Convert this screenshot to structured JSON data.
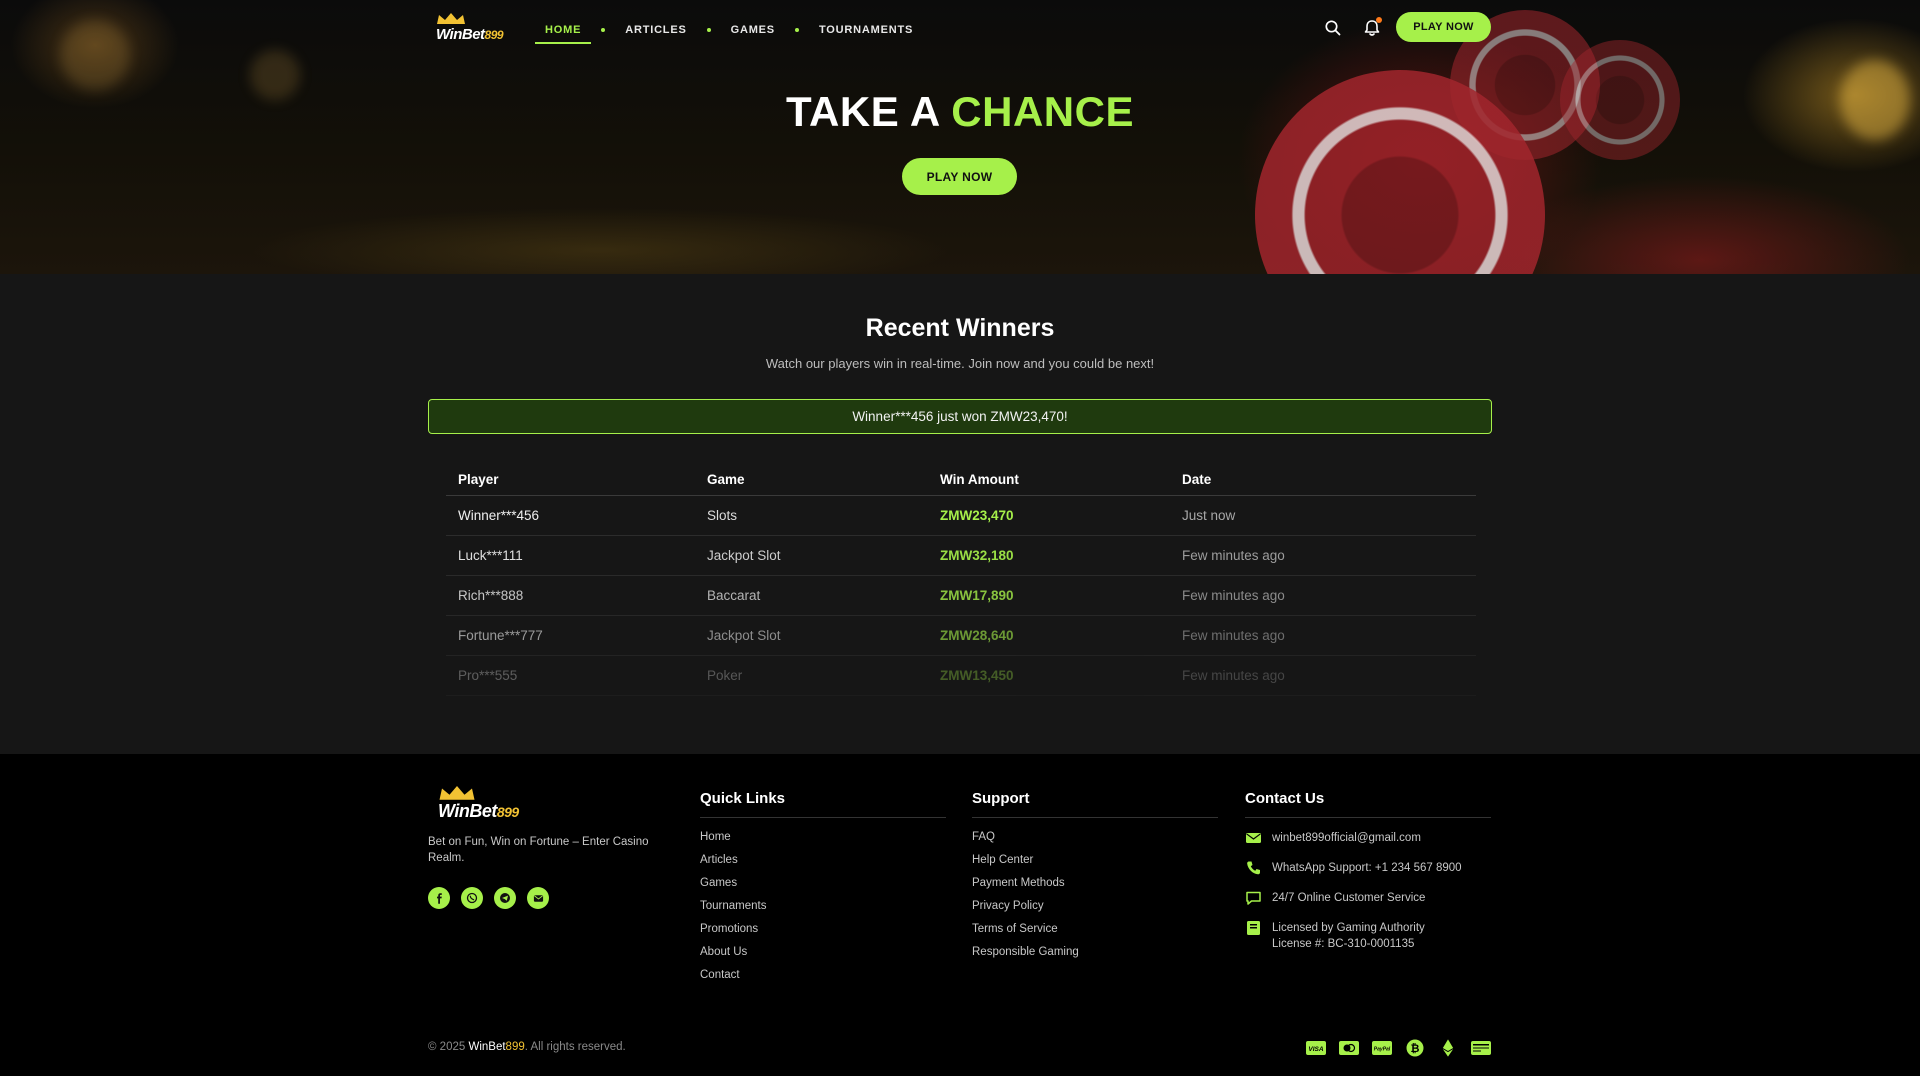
{
  "brand": {
    "name_main": "WinBet",
    "name_num": "899"
  },
  "nav": {
    "items": [
      {
        "label": "HOME",
        "active": true
      },
      {
        "label": "ARTICLES",
        "active": false
      },
      {
        "label": "GAMES",
        "active": false
      },
      {
        "label": "TOURNAMENTS",
        "active": false
      }
    ],
    "search_icon": "search-icon",
    "bell_icon": "bell-icon",
    "cta_label": "PLAY NOW"
  },
  "hero": {
    "title_prefix": "TAKE A",
    "title_accent": "CHANCE",
    "cta_label": "PLAY NOW"
  },
  "winners": {
    "title": "Recent Winners",
    "subtitle": "Watch our players win in real-time. Join now and you could be next!",
    "ticker": "Winner***456 just won ZMW23,470!",
    "headers": {
      "player": "Player",
      "game": "Game",
      "amount": "Win Amount",
      "date": "Date"
    },
    "rows": [
      {
        "player": "Winner***456",
        "game": "Slots",
        "amount": "ZMW23,470",
        "date": "Just now"
      },
      {
        "player": "Luck***111",
        "game": "Jackpot Slot",
        "amount": "ZMW32,180",
        "date": "Few minutes ago"
      },
      {
        "player": "Rich***888",
        "game": "Baccarat",
        "amount": "ZMW17,890",
        "date": "Few minutes ago"
      },
      {
        "player": "Fortune***777",
        "game": "Jackpot Slot",
        "amount": "ZMW28,640",
        "date": "Few minutes ago"
      },
      {
        "player": "Pro***555",
        "game": "Poker",
        "amount": "ZMW13,450",
        "date": "Few minutes ago"
      }
    ]
  },
  "footer": {
    "tagline": "Bet on Fun, Win on Fortune – Enter Casino Realm.",
    "socials": [
      "facebook-icon",
      "whatsapp-icon",
      "telegram-icon",
      "email-icon"
    ],
    "quick_links": {
      "title": "Quick Links",
      "links": [
        "Home",
        "Articles",
        "Games",
        "Tournaments",
        "Promotions",
        "About Us",
        "Contact"
      ]
    },
    "support": {
      "title": "Support",
      "links": [
        "FAQ",
        "Help Center",
        "Payment Methods",
        "Privacy Policy",
        "Terms of Service",
        "Responsible Gaming"
      ]
    },
    "contact": {
      "title": "Contact Us",
      "email": "winbet899official@gmail.com",
      "whatsapp": "WhatsApp Support: +1 234 567 8900",
      "service": "24/7 Online Customer Service",
      "license_line1": "Licensed by Gaming Authority",
      "license_line2": "License #: BC-310-0001135"
    },
    "copyright_prefix": "© 2025",
    "copyright_suffix": ". All rights reserved.",
    "payments": [
      "visa-icon",
      "mastercard-icon",
      "paypal-icon",
      "bitcoin-icon",
      "ethereum-icon",
      "bank-card-icon"
    ]
  },
  "colors": {
    "accent": "#a6f04a",
    "gold": "#f2c233",
    "notification": "#ff7a1a"
  }
}
